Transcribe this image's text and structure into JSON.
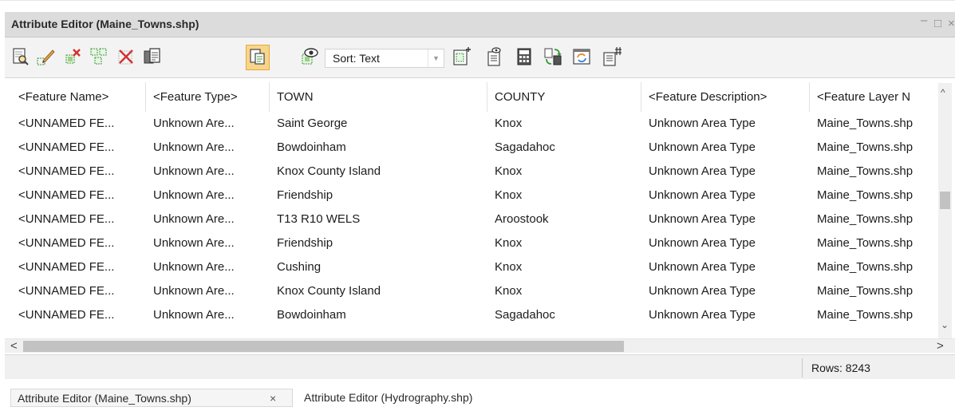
{
  "window": {
    "title": "Attribute Editor (Maine_Towns.shp)",
    "minimize": "–",
    "maximize": "□",
    "close": "×"
  },
  "toolbar": {
    "buttons": [
      {
        "name": "query-icon"
      },
      {
        "name": "edit-pencil-icon"
      },
      {
        "name": "delete-selected-icon"
      },
      {
        "name": "select-features-icon"
      },
      {
        "name": "delete-icon"
      },
      {
        "name": "copy-icon"
      },
      {
        "name": "paste-icon",
        "active": true
      },
      {
        "name": "view-feature-icon"
      },
      {
        "name": "add-column-icon"
      },
      {
        "name": "column-properties-icon"
      },
      {
        "name": "calculator-icon"
      },
      {
        "name": "swap-icon"
      },
      {
        "name": "refresh-icon"
      },
      {
        "name": "column-settings-icon"
      }
    ],
    "sort": {
      "value": "Sort: Text",
      "arrow": "▼"
    }
  },
  "table": {
    "columns": [
      "<Feature Name>",
      "<Feature Type>",
      "TOWN",
      "COUNTY",
      "<Feature Description>",
      "<Feature Layer N"
    ],
    "rows": [
      [
        "<UNNAMED FE...",
        "Unknown Are...",
        "Saint George",
        "Knox",
        "Unknown Area Type",
        "Maine_Towns.shp"
      ],
      [
        "<UNNAMED FE...",
        "Unknown Are...",
        "Bowdoinham",
        "Sagadahoc",
        "Unknown Area Type",
        "Maine_Towns.shp"
      ],
      [
        "<UNNAMED FE...",
        "Unknown Are...",
        "Knox County Island",
        "Knox",
        "Unknown Area Type",
        "Maine_Towns.shp"
      ],
      [
        "<UNNAMED FE...",
        "Unknown Are...",
        "Friendship",
        "Knox",
        "Unknown Area Type",
        "Maine_Towns.shp"
      ],
      [
        "<UNNAMED FE...",
        "Unknown Are...",
        "T13 R10 WELS",
        "Aroostook",
        "Unknown Area Type",
        "Maine_Towns.shp"
      ],
      [
        "<UNNAMED FE...",
        "Unknown Are...",
        "Friendship",
        "Knox",
        "Unknown Area Type",
        "Maine_Towns.shp"
      ],
      [
        "<UNNAMED FE...",
        "Unknown Are...",
        "Cushing",
        "Knox",
        "Unknown Area Type",
        "Maine_Towns.shp"
      ],
      [
        "<UNNAMED FE...",
        "Unknown Are...",
        "Knox County Island",
        "Knox",
        "Unknown Area Type",
        "Maine_Towns.shp"
      ],
      [
        "<UNNAMED FE...",
        "Unknown Are...",
        "Bowdoinham",
        "Sagadahoc",
        "Unknown Area Type",
        "Maine_Towns.shp"
      ]
    ]
  },
  "scroll": {
    "up": "^",
    "down": "⌄",
    "left": "<",
    "right": ">"
  },
  "status": {
    "rows": "Rows: 8243"
  },
  "tabs": [
    {
      "label": "Attribute Editor (Maine_Towns.shp)",
      "close": "×"
    },
    {
      "label": "Attribute Editor (Hydrography.shp)"
    }
  ],
  "colors": {
    "active_button_fill": "#f7d58b",
    "active_button_border": "#e8a73c",
    "title_strip": "#dcdcdc"
  }
}
